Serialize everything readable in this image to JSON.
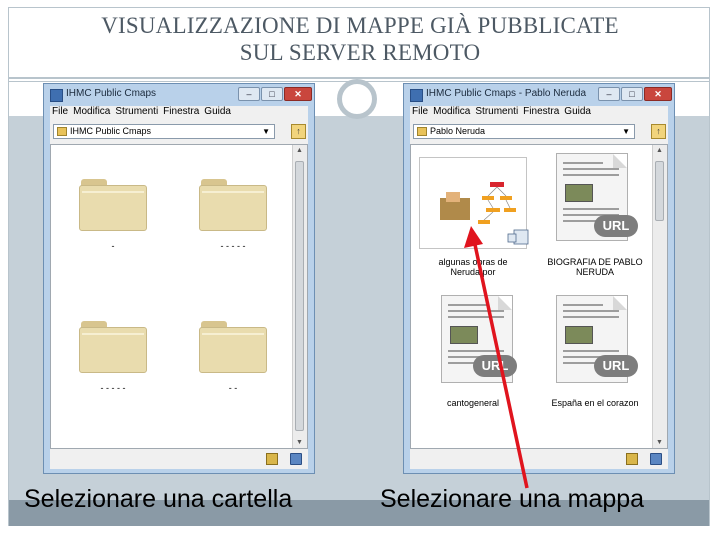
{
  "slide": {
    "title_line1": "VISUALIZZAZIONE DI MAPPE GIÀ PUBBLICATE",
    "title_line2": "SUL SERVER REMOTO",
    "caption_left": "Selezionare una cartella",
    "caption_right": "Selezionare una mappa"
  },
  "left_window": {
    "title": "IHMC Public Cmaps",
    "menu": [
      "File",
      "Modifica",
      "Strumenti",
      "Finestra",
      "Guida"
    ],
    "path_value": "IHMC Public Cmaps",
    "folders": [
      {
        "label": "-"
      },
      {
        "label": "- - - - -"
      },
      {
        "label": "- - - - -"
      },
      {
        "label": "- -"
      }
    ]
  },
  "right_window": {
    "title": "IHMC Public Cmaps - Pablo Neruda",
    "menu": [
      "File",
      "Modifica",
      "Strumenti",
      "Finestra",
      "Guida"
    ],
    "path_value": "Pablo Neruda",
    "items": [
      {
        "label_line1": "algunas obras de",
        "label_line2": "Neruda por",
        "kind": "cmap"
      },
      {
        "label_line1": "BIOGRAFIA DE PABLO",
        "label_line2": "NERUDA",
        "kind": "url",
        "badge": "URL"
      },
      {
        "label_line1": "cantogeneral",
        "label_line2": "",
        "kind": "url",
        "badge": "URL"
      },
      {
        "label_line1": "España en el corazon",
        "label_line2": "",
        "kind": "url",
        "badge": "URL"
      }
    ]
  },
  "window_controls": {
    "minimize": "–",
    "maximize": "□",
    "close": "✕"
  },
  "colors": {
    "arrow": "#e0141e",
    "frame": "#b8c4cc",
    "band": "#c5d0d8",
    "bottom_band": "#8a9aa6"
  }
}
